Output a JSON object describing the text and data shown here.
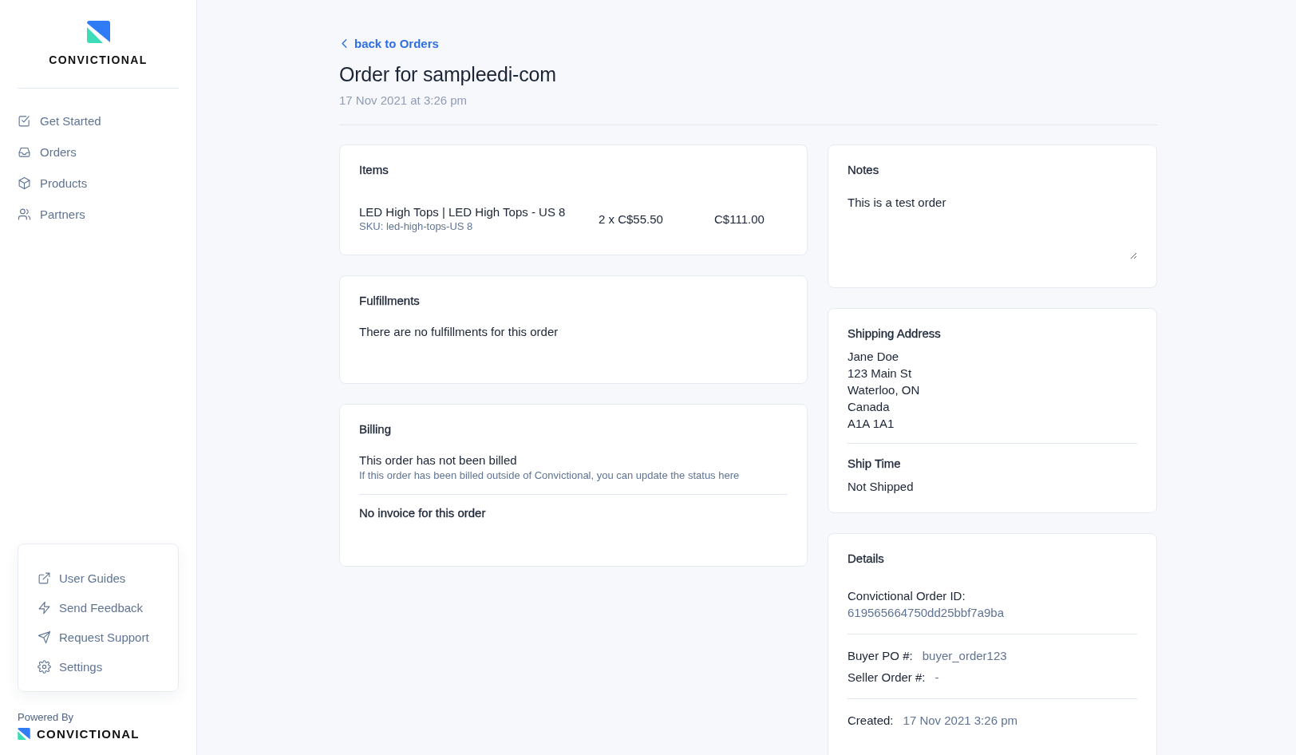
{
  "sidebar": {
    "brand": "CONVICTIONAL",
    "nav": [
      {
        "label": "Get Started",
        "selected": false
      },
      {
        "label": "Orders",
        "selected": false
      },
      {
        "label": "Products",
        "selected": false
      },
      {
        "label": "Partners",
        "selected": false
      }
    ],
    "help": [
      {
        "label": "User Guides"
      },
      {
        "label": "Send Feedback"
      },
      {
        "label": "Request Support"
      },
      {
        "label": "Settings"
      }
    ],
    "powered_by": "Powered By",
    "footer_brand": "CONVICTIONAL"
  },
  "header": {
    "back_link": "back to Orders",
    "title": "Order for sampleedi-com",
    "date": "17 Nov 2021 at 3:26 pm"
  },
  "items": {
    "title": "Items",
    "rows": [
      {
        "name": "LED High Tops | LED High Tops - US 8",
        "sku": "SKU: led-high-tops-US 8",
        "quantity_price": "2 x C$55.50",
        "total": "C$111.00"
      }
    ]
  },
  "fulfillments": {
    "title": "Fulfillments",
    "message": "There are no fulfillments for this order"
  },
  "billing": {
    "title": "Billing",
    "status": "This order has not been billed",
    "hint": "If this order has been billed outside of Convictional, you can update the status here",
    "invoice": "No invoice for this order"
  },
  "notes": {
    "title": "Notes",
    "value": "This is a test order"
  },
  "shipping": {
    "title": "Shipping Address",
    "address": [
      "Jane Doe",
      "123 Main St",
      "Waterloo, ON",
      "Canada",
      "A1A 1A1"
    ],
    "ship_time_title": "Ship Time",
    "ship_time": "Not Shipped"
  },
  "details": {
    "title": "Details",
    "groups": [
      [
        {
          "kind": "stacked",
          "label": "Convictional Order ID:",
          "value": "619565664750dd25bbf7a9ba"
        }
      ],
      [
        {
          "kind": "inline",
          "label": "Buyer PO #:",
          "value": "buyer_order123"
        },
        {
          "kind": "inline",
          "label": "Seller Order #:",
          "value": "-"
        }
      ],
      [
        {
          "kind": "inline",
          "label": "Created:",
          "value": "17 Nov 2021 3:26 pm"
        }
      ]
    ]
  }
}
